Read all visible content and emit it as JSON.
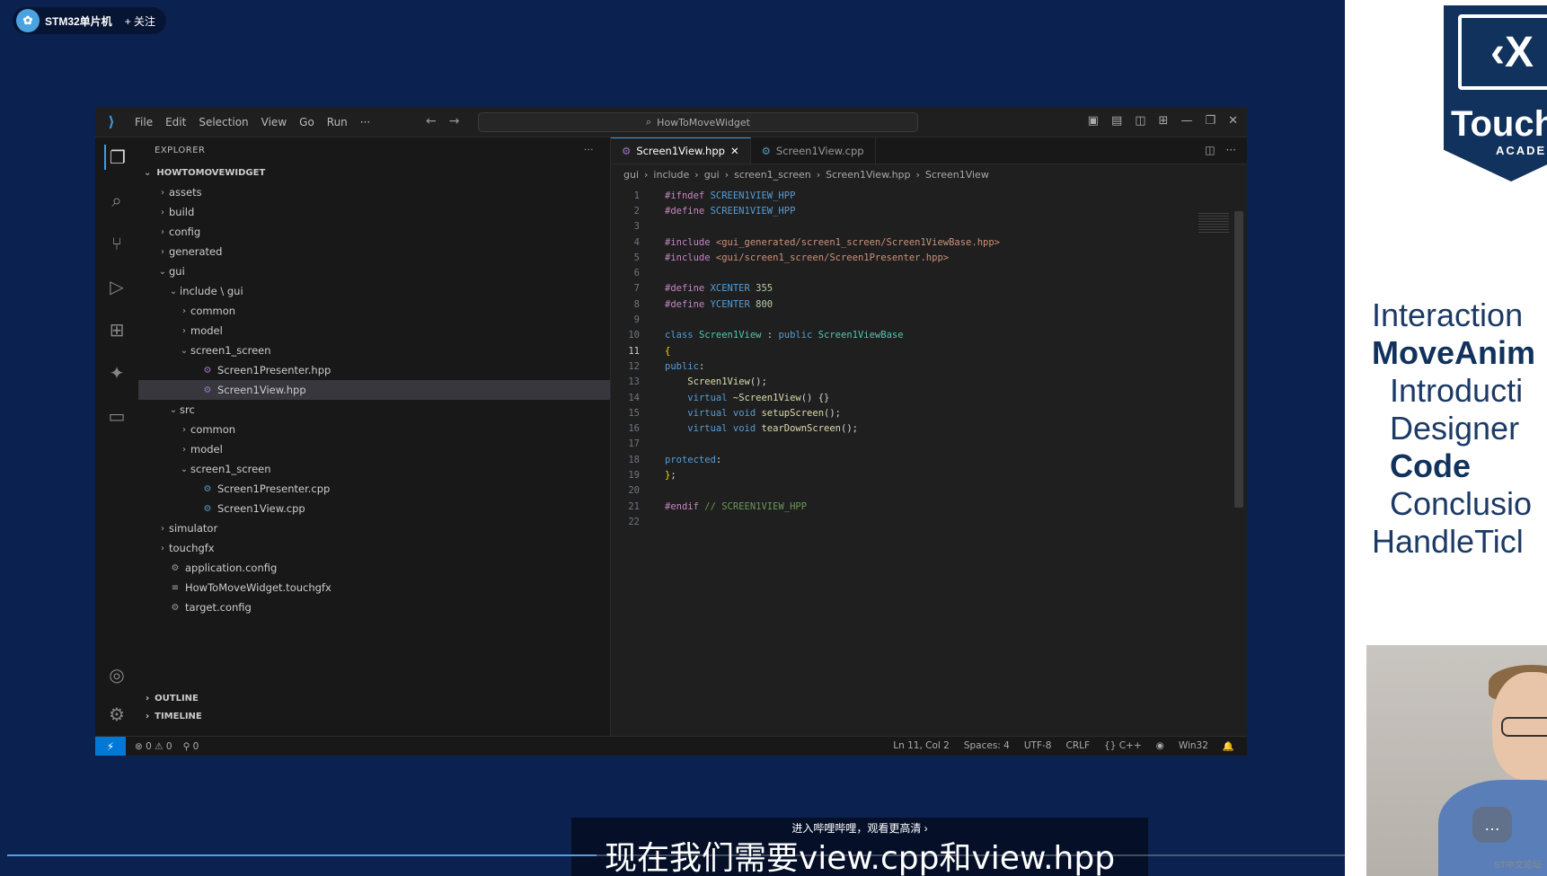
{
  "channel": {
    "logo_glyph": "✿",
    "name": "STM32单片机",
    "follow": "+ 关注"
  },
  "vscode": {
    "menu": [
      "File",
      "Edit",
      "Selection",
      "View",
      "Go",
      "Run",
      "···"
    ],
    "nav_back": "←",
    "nav_fwd": "→",
    "search_icon": "⌕",
    "command_center": "HowToMoveWidget",
    "window_controls": [
      "▣",
      "▤",
      "◫",
      "⊞",
      "—",
      "❐",
      "✕"
    ],
    "activity_icons": [
      "files-icon",
      "search-icon",
      "source-control-icon",
      "run-debug-icon",
      "extensions-icon",
      "touchgfx-icon",
      "remote-explorer-icon"
    ],
    "explorer": {
      "header": "EXPLORER",
      "more": "···",
      "root": "HOWTOMOVEWIDGET",
      "tree": [
        {
          "label": "assets",
          "depth": 1,
          "kind": "folder",
          "open": false
        },
        {
          "label": "build",
          "depth": 1,
          "kind": "folder",
          "open": false
        },
        {
          "label": "config",
          "depth": 1,
          "kind": "folder",
          "open": false
        },
        {
          "label": "generated",
          "depth": 1,
          "kind": "folder",
          "open": false
        },
        {
          "label": "gui",
          "depth": 1,
          "kind": "folder",
          "open": true
        },
        {
          "label": "include \\ gui",
          "depth": 2,
          "kind": "folder",
          "open": true
        },
        {
          "label": "common",
          "depth": 3,
          "kind": "folder",
          "open": false
        },
        {
          "label": "model",
          "depth": 3,
          "kind": "folder",
          "open": false
        },
        {
          "label": "screen1_screen",
          "depth": 3,
          "kind": "folder",
          "open": true
        },
        {
          "label": "Screen1Presenter.hpp",
          "depth": 4,
          "kind": "hpp"
        },
        {
          "label": "Screen1View.hpp",
          "depth": 4,
          "kind": "hpp",
          "selected": true
        },
        {
          "label": "src",
          "depth": 2,
          "kind": "folder",
          "open": true
        },
        {
          "label": "common",
          "depth": 3,
          "kind": "folder",
          "open": false
        },
        {
          "label": "model",
          "depth": 3,
          "kind": "folder",
          "open": false
        },
        {
          "label": "screen1_screen",
          "depth": 3,
          "kind": "folder",
          "open": true
        },
        {
          "label": "Screen1Presenter.cpp",
          "depth": 4,
          "kind": "cpp"
        },
        {
          "label": "Screen1View.cpp",
          "depth": 4,
          "kind": "cpp"
        },
        {
          "label": "simulator",
          "depth": 1,
          "kind": "folder",
          "open": false
        },
        {
          "label": "touchgfx",
          "depth": 1,
          "kind": "folder",
          "open": false
        },
        {
          "label": "application.config",
          "depth": 1,
          "kind": "config"
        },
        {
          "label": "HowToMoveWidget.touchgfx",
          "depth": 1,
          "kind": "touchgfx"
        },
        {
          "label": "target.config",
          "depth": 1,
          "kind": "config"
        }
      ],
      "outline": "OUTLINE",
      "timeline": "TIMELINE"
    },
    "tabs": [
      {
        "label": "Screen1View.hpp",
        "active": true,
        "close": "✕"
      },
      {
        "label": "Screen1View.cpp",
        "active": false,
        "close": ""
      }
    ],
    "tab_actions": [
      "◫",
      "···"
    ],
    "breadcrumb": [
      "gui",
      "include",
      "gui",
      "screen1_screen",
      "Screen1View.hpp",
      "Screen1View"
    ],
    "code_lines": [
      [
        [
          "k-pre",
          "#ifndef "
        ],
        [
          "k-mac",
          "SCREEN1VIEW_HPP"
        ]
      ],
      [
        [
          "k-pre",
          "#define "
        ],
        [
          "k-mac",
          "SCREEN1VIEW_HPP"
        ]
      ],
      [],
      [
        [
          "k-pre",
          "#include "
        ],
        [
          "k-str",
          "<gui_generated/screen1_screen/Screen1ViewBase.hpp>"
        ]
      ],
      [
        [
          "k-pre",
          "#include "
        ],
        [
          "k-str",
          "<gui/screen1_screen/Screen1Presenter.hpp>"
        ]
      ],
      [],
      [
        [
          "k-pre",
          "#define "
        ],
        [
          "k-mac",
          "XCENTER "
        ],
        [
          "k-num",
          "355"
        ]
      ],
      [
        [
          "k-pre",
          "#define "
        ],
        [
          "k-mac",
          "YCENTER "
        ],
        [
          "k-num",
          "800"
        ]
      ],
      [],
      [
        [
          "k-kw",
          "class "
        ],
        [
          "k-type",
          "Screen1View "
        ],
        [
          "k-pl",
          ": "
        ],
        [
          "k-kw",
          "public "
        ],
        [
          "k-type",
          "Screen1ViewBase"
        ]
      ],
      [
        [
          "k-br",
          "{"
        ]
      ],
      [
        [
          "k-kw",
          "public"
        ],
        [
          "k-pl",
          ":"
        ]
      ],
      [
        [
          "k-pl",
          "    "
        ],
        [
          "k-fn",
          "Screen1View"
        ],
        [
          "k-pl",
          "();"
        ]
      ],
      [
        [
          "k-pl",
          "    "
        ],
        [
          "k-kw",
          "virtual "
        ],
        [
          "k-fn",
          "~Screen1View"
        ],
        [
          "k-pl",
          "() {}"
        ]
      ],
      [
        [
          "k-pl",
          "    "
        ],
        [
          "k-kw",
          "virtual void "
        ],
        [
          "k-fn",
          "setupScreen"
        ],
        [
          "k-pl",
          "();"
        ]
      ],
      [
        [
          "k-pl",
          "    "
        ],
        [
          "k-kw",
          "virtual void "
        ],
        [
          "k-fn",
          "tearDownScreen"
        ],
        [
          "k-pl",
          "();"
        ]
      ],
      [],
      [
        [
          "k-kw",
          "protected"
        ],
        [
          "k-pl",
          ":"
        ]
      ],
      [
        [
          "k-br",
          "}"
        ],
        [
          "k-pl",
          ";"
        ]
      ],
      [],
      [
        [
          "k-pre",
          "#endif "
        ],
        [
          "k-com",
          "// SCREEN1VIEW_HPP"
        ]
      ],
      []
    ],
    "current_line": 11,
    "status": {
      "remote": "⚡",
      "problems": "⊗ 0  ⚠ 0",
      "ports": "⚲ 0",
      "position": "Ln 11, Col 2",
      "spaces": "Spaces: 4",
      "encoding": "UTF-8",
      "eol": "CRLF",
      "language": "{} C++",
      "copilot": "◉",
      "platform": "Win32",
      "bell": "🔔"
    }
  },
  "slide": {
    "logo_glyph": "‹X",
    "brand": "Touch",
    "academy": "ACADE",
    "agenda": [
      {
        "label": "Interaction",
        "bold": false,
        "indent": false
      },
      {
        "label": "MoveAnim",
        "bold": true,
        "indent": false
      },
      {
        "label": "Introducti",
        "bold": false,
        "indent": true
      },
      {
        "label": "Designer",
        "bold": false,
        "indent": true
      },
      {
        "label": "Code",
        "bold": true,
        "indent": true
      },
      {
        "label": "Conclusio",
        "bold": false,
        "indent": true
      },
      {
        "label": "HandleTicl",
        "bold": false,
        "indent": false
      }
    ],
    "watermark": "ST中文论坛"
  },
  "subtitle": {
    "hint": "进入哔哩哔哩，观看更高清 ›",
    "text": "现在我们需要view.cpp和view.hpp"
  }
}
